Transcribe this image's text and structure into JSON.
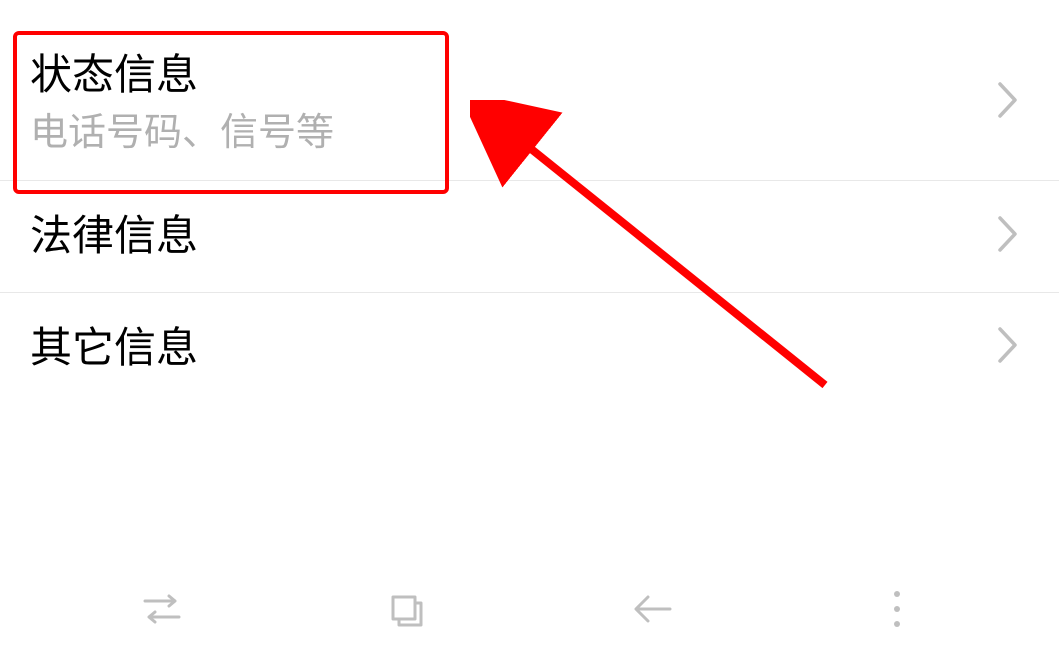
{
  "list": {
    "items": [
      {
        "title": "状态信息",
        "subtitle": "电话号码、信号等"
      },
      {
        "title": "法律信息"
      },
      {
        "title": "其它信息"
      }
    ]
  }
}
